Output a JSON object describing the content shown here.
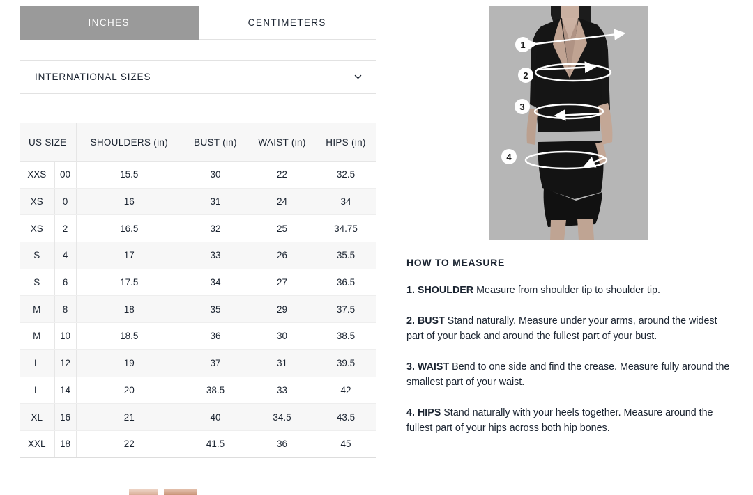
{
  "units": {
    "tabs": [
      {
        "label": "INCHES",
        "active": true
      },
      {
        "label": "CENTIMETERS",
        "active": false
      }
    ]
  },
  "international_sizes": {
    "label": "INTERNATIONAL SIZES",
    "icon": "chevron-down-icon",
    "expanded": false
  },
  "size_chart": {
    "columns": [
      "US SIZE",
      "SHOULDERS (in)",
      "BUST (in)",
      "WAIST (in)",
      "HIPS (in)"
    ],
    "rows": [
      {
        "letter": "XXS",
        "number": "00",
        "shoulders": "15.5",
        "bust": "30",
        "waist": "22",
        "hips": "32.5"
      },
      {
        "letter": "XS",
        "number": "0",
        "shoulders": "16",
        "bust": "31",
        "waist": "24",
        "hips": "34"
      },
      {
        "letter": "XS",
        "number": "2",
        "shoulders": "16.5",
        "bust": "32",
        "waist": "25",
        "hips": "34.75"
      },
      {
        "letter": "S",
        "number": "4",
        "shoulders": "17",
        "bust": "33",
        "waist": "26",
        "hips": "35.5"
      },
      {
        "letter": "S",
        "number": "6",
        "shoulders": "17.5",
        "bust": "34",
        "waist": "27",
        "hips": "36.5"
      },
      {
        "letter": "M",
        "number": "8",
        "shoulders": "18",
        "bust": "35",
        "waist": "29",
        "hips": "37.5"
      },
      {
        "letter": "M",
        "number": "10",
        "shoulders": "18.5",
        "bust": "36",
        "waist": "30",
        "hips": "38.5"
      },
      {
        "letter": "L",
        "number": "12",
        "shoulders": "19",
        "bust": "37",
        "waist": "31",
        "hips": "39.5"
      },
      {
        "letter": "L",
        "number": "14",
        "shoulders": "20",
        "bust": "38.5",
        "waist": "33",
        "hips": "42"
      },
      {
        "letter": "XL",
        "number": "16",
        "shoulders": "21",
        "bust": "40",
        "waist": "34.5",
        "hips": "43.5"
      },
      {
        "letter": "XXL",
        "number": "18",
        "shoulders": "22",
        "bust": "41.5",
        "waist": "36",
        "hips": "45"
      }
    ]
  },
  "diagram": {
    "alt": "model-measurement-diagram",
    "markers": [
      "1",
      "2",
      "3",
      "4"
    ],
    "marker_labels": {
      "1": "shoulder-marker",
      "2": "bust-marker",
      "3": "waist-marker",
      "4": "hips-marker"
    }
  },
  "how_to_measure": {
    "title": "HOW TO MEASURE",
    "steps": [
      {
        "num": "1. ",
        "term": "SHOULDER",
        "text": " Measure from shoulder tip to shoulder tip."
      },
      {
        "num": "2. ",
        "term": "BUST",
        "text": "  Stand naturally. Measure under your arms, around the widest part of your back and around the fullest part of your bust."
      },
      {
        "num": "3. ",
        "term": "WAIST",
        "text": " Bend to one side and find the crease. Measure fully around the smallest part of your waist."
      },
      {
        "num": "4. ",
        "term": "HIPS",
        "text": " Stand naturally with your heels together. Measure around the fullest part of your hips across both hip bones."
      }
    ]
  },
  "colors": {
    "active_tab_bg": "#9a9a9a",
    "border": "#e2e2e2",
    "header_bg": "#f7f7f7",
    "row_alt_bg": "#f7f7f7",
    "text": "#1a2330",
    "photo_bg": "#b6b6b6"
  }
}
